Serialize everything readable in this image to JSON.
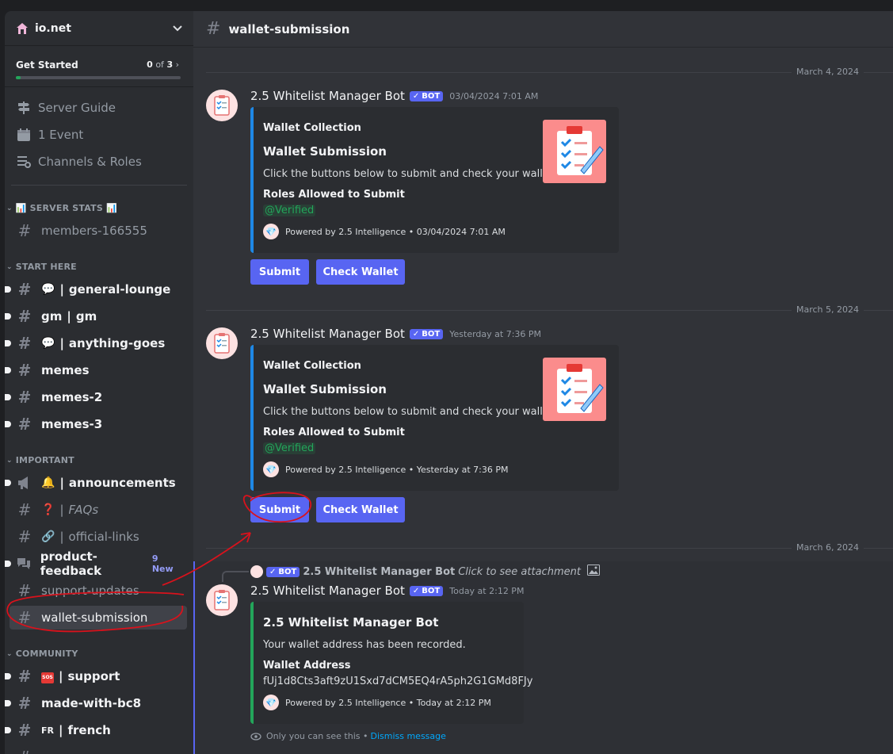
{
  "server": {
    "name": "io.net"
  },
  "get_started": {
    "title": "Get Started",
    "done": "0",
    "of": "of",
    "total": "3",
    "progress": 0.03
  },
  "nav": [
    {
      "label": "Server Guide",
      "icon": "signpost-icon"
    },
    {
      "label": "1 Event",
      "icon": "calendar-icon"
    },
    {
      "label": "Channels & Roles",
      "icon": "list-icon"
    }
  ],
  "categories": {
    "server_stats": "SERVER STATS",
    "start_here": "START HERE",
    "important": "IMPORTANT",
    "community": "COMMUNITY"
  },
  "channels": {
    "members": "members-166555",
    "general_lounge": "general-lounge",
    "gm_a": "gm",
    "gm_b": "gm",
    "anything_goes": "anything-goes",
    "memes": "memes",
    "memes2": "memes-2",
    "memes3": "memes-3",
    "announcements": "announcements",
    "faqs": "FAQs",
    "official_links": "official-links",
    "product_feedback": "product-feedback",
    "product_feedback_badge": "9 New",
    "support_updates": "support-updates",
    "wallet_submission": "wallet-submission",
    "support": "support",
    "made_with": "made-with-bc8",
    "french_tag": "FR",
    "french": "french",
    "separator": "|"
  },
  "header": {
    "channel": "wallet-submission"
  },
  "dates": {
    "d1": "March 4, 2024",
    "d2": "March 5, 2024",
    "d3": "March 6, 2024"
  },
  "messages": [
    {
      "author": "2.5 Whitelist Manager Bot",
      "badge": "BOT",
      "timestamp": "03/04/2024 7:01 AM",
      "embed": {
        "provider": "Wallet Collection",
        "title": "Wallet Submission",
        "description": "Click the buttons below to submit and check your wallet.",
        "field_name": "Roles Allowed to Submit",
        "field_value": "@Verified",
        "footer": "Powered by 2.5 Intelligence • 03/04/2024 7:01 AM"
      },
      "buttons": [
        "Submit",
        "Check Wallet"
      ]
    },
    {
      "author": "2.5 Whitelist Manager Bot",
      "badge": "BOT",
      "timestamp": "Yesterday at 7:36 PM",
      "embed": {
        "provider": "Wallet Collection",
        "title": "Wallet Submission",
        "description": "Click the buttons below to submit and check your wallet.",
        "field_name": "Roles Allowed to Submit",
        "field_value": "@Verified",
        "footer": "Powered by 2.5 Intelligence • Yesterday at 7:36 PM"
      },
      "buttons": [
        "Submit",
        "Check Wallet"
      ]
    },
    {
      "reply": {
        "badge": "BOT",
        "author": "2.5 Whitelist Manager Bot",
        "text": "Click to see attachment"
      },
      "author": "2.5 Whitelist Manager Bot",
      "badge": "BOT",
      "timestamp": "Today at 2:12 PM",
      "embed": {
        "title": "2.5 Whitelist Manager Bot",
        "description": "Your wallet address has been recorded.",
        "field_name": "Wallet Address",
        "field_value": "fUj1d8Cts3aft9zU1Sxd7dCM5EQ4rA5ph2G1GMd8FJy",
        "footer": "Powered by 2.5 Intelligence • Today at 2:12 PM"
      },
      "ephemeral": {
        "text": "Only you can see this •",
        "dismiss": "Dismiss message"
      }
    }
  ],
  "colors": {
    "blurple": "#5865f2",
    "embed_blue": "#1e88e5",
    "embed_green": "#23a55a",
    "annotation_red": "#d9121c"
  }
}
